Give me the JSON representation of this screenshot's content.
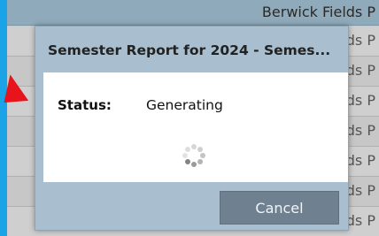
{
  "background": {
    "header_text": "Berwick Fields P",
    "row_fragments": [
      "ds P",
      "ds P",
      "ds P",
      "ds P",
      "ds P",
      "ds P",
      "ds P"
    ]
  },
  "dialog": {
    "title": "Semester Report for 2024 - Semes...",
    "status_label": "Status:",
    "status_value": "Generating",
    "cancel_label": "Cancel"
  },
  "colors": {
    "accent_blue": "#1aa3e6",
    "dialog_frame": "#a9bfcf",
    "button_bg": "#6f8190",
    "arrow_red": "#e8141c"
  },
  "icons": {
    "spinner": "loading-spinner-icon",
    "arrow": "pointer-arrow-icon"
  }
}
